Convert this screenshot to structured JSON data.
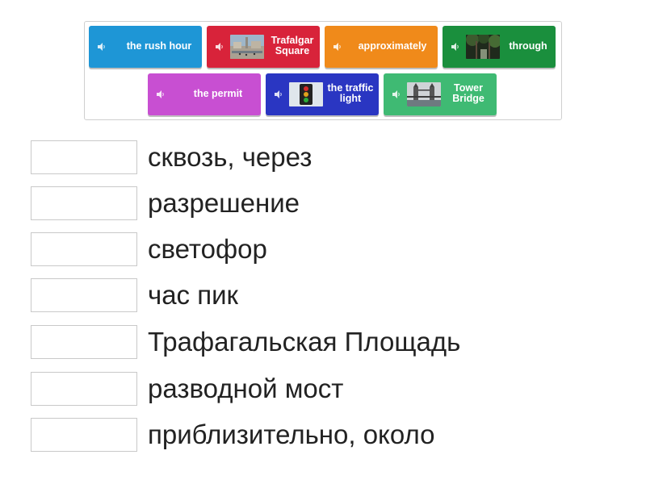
{
  "tiles": [
    {
      "label": "the rush hour",
      "color": "#1e96d6",
      "image": null
    },
    {
      "label": "Trafalgar Square",
      "color": "#d8233a",
      "image": "trafalgar-square-photo"
    },
    {
      "label": "approximately",
      "color": "#f08a1a",
      "image": null
    },
    {
      "label": "through",
      "color": "#1a8f3d",
      "image": "forest-photo"
    },
    {
      "label": "the permit",
      "color": "#c84fd2",
      "image": null
    },
    {
      "label": "the traffic light",
      "color": "#2a36c2",
      "image": "traffic-light-photo"
    },
    {
      "label": "Tower Bridge",
      "color": "#3fba73",
      "image": "tower-bridge-photo"
    }
  ],
  "icons": {
    "tile_audio": "speaker-icon"
  },
  "answers": [
    {
      "text": "сквозь, через"
    },
    {
      "text": "разрешение"
    },
    {
      "text": "светофор"
    },
    {
      "text": "час пик"
    },
    {
      "text": "Трафагальская Площадь"
    },
    {
      "text": "разводной мост"
    },
    {
      "text": "приблизительно, около"
    }
  ]
}
